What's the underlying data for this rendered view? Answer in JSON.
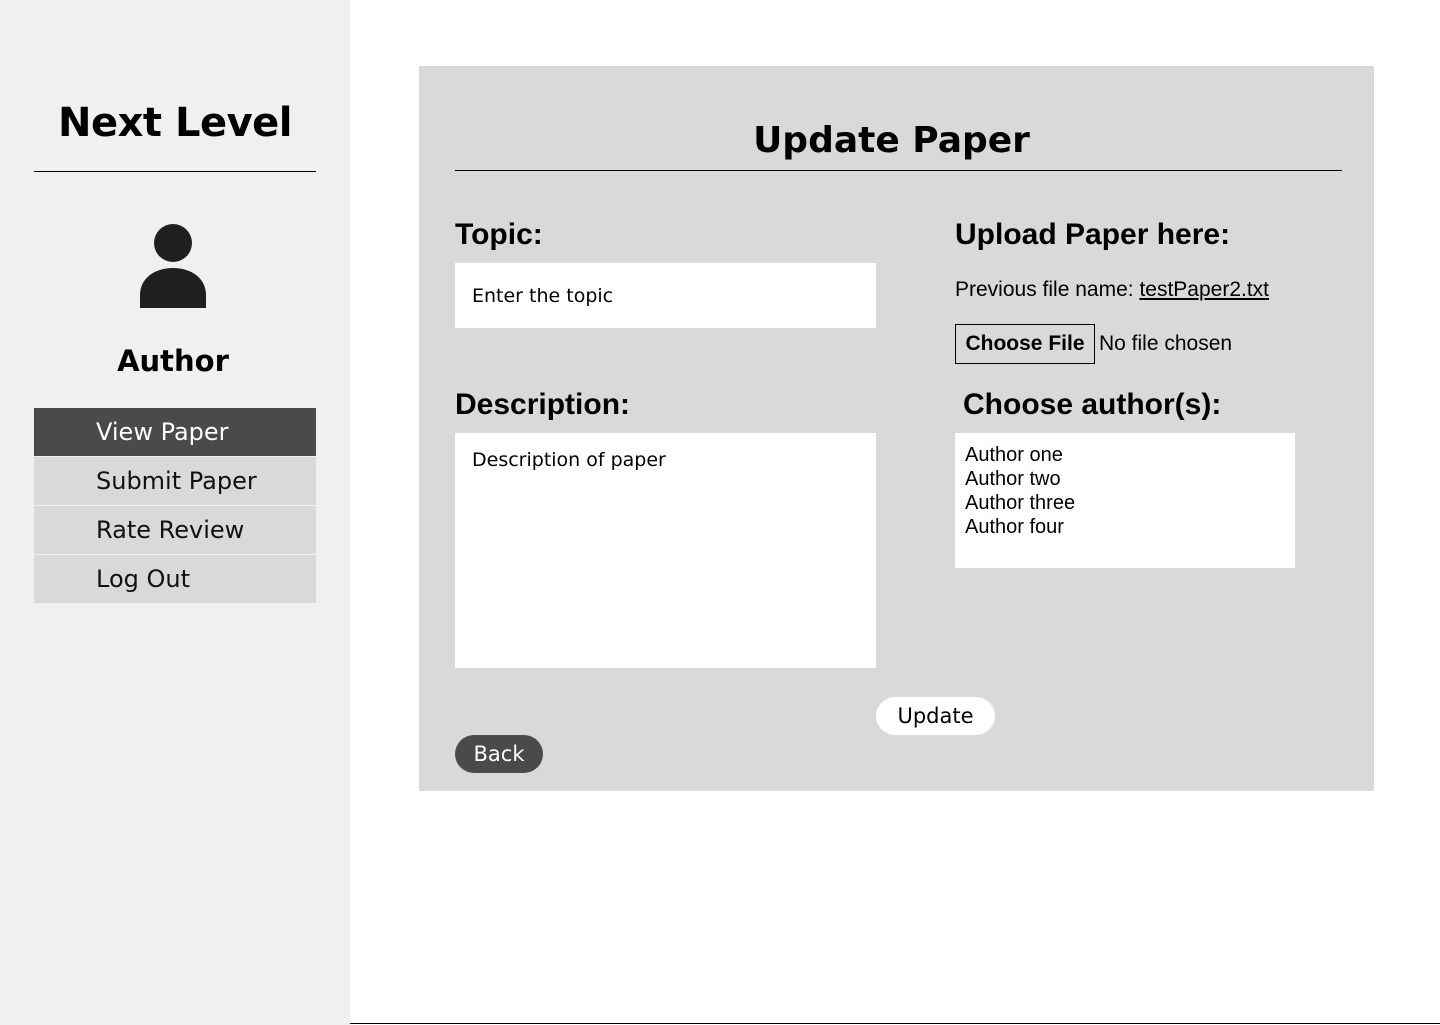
{
  "sidebar": {
    "brand": "Next Level",
    "role": "Author",
    "nav": [
      {
        "label": "View Paper",
        "active": true
      },
      {
        "label": "Submit Paper",
        "active": false
      },
      {
        "label": "Rate Review",
        "active": false
      },
      {
        "label": "Log Out",
        "active": false
      }
    ]
  },
  "form": {
    "title": "Update Paper",
    "topic_label": "Topic:",
    "topic_placeholder": "Enter the topic",
    "description_label": "Description:",
    "description_placeholder": "Description of paper",
    "upload_label": "Upload Paper here:",
    "previous_file_prefix": "Previous file name:",
    "previous_file_name": "testPaper2.txt",
    "choose_file_label": "Choose File",
    "no_file_text": "No file chosen",
    "authors_label": "Choose author(s):",
    "authors": [
      "Author one",
      "Author two",
      "Author three",
      "Author four"
    ],
    "update_label": "Update",
    "back_label": "Back"
  },
  "colors": {
    "sidebar_bg": "#f0f0f0",
    "panel_bg": "#d9d9d9",
    "active_nav": "#4a4a4a"
  },
  "icons": {
    "avatar": "user-icon"
  }
}
